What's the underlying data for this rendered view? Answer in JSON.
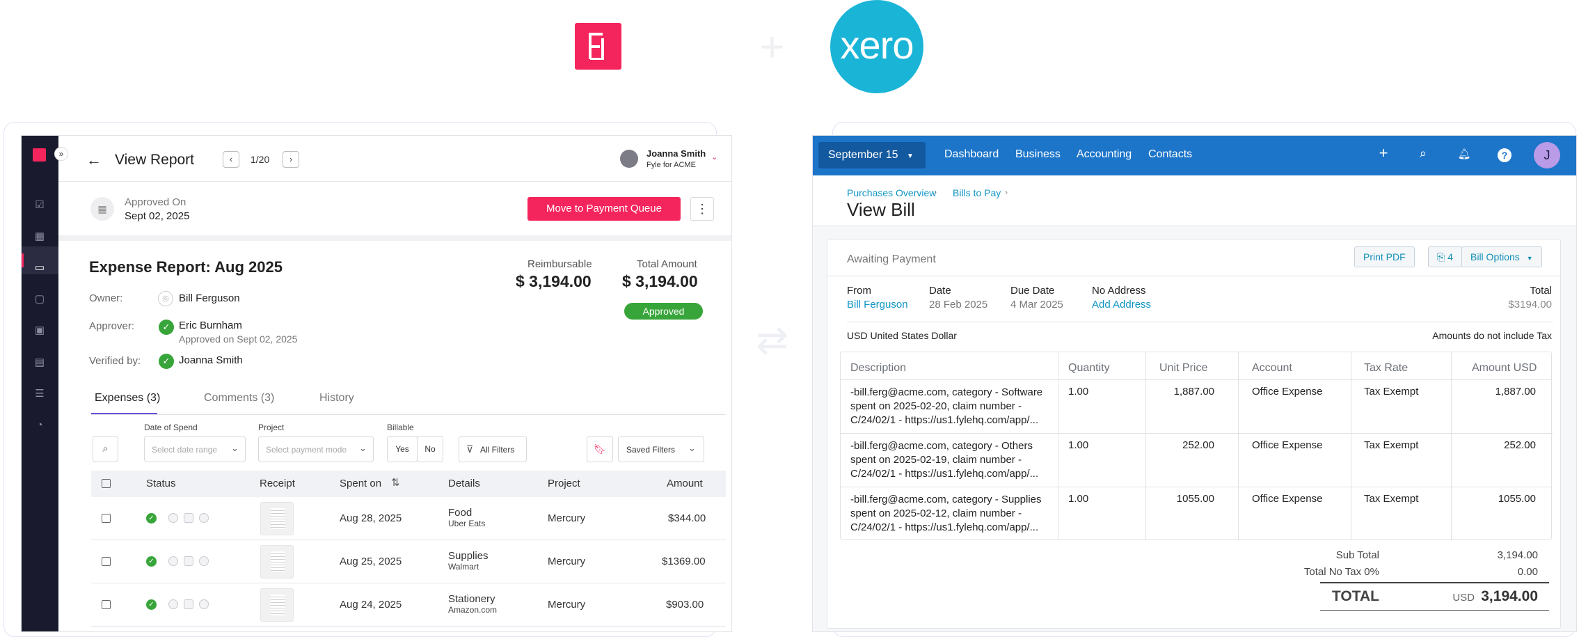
{
  "fyle": {
    "header": {
      "title": "View Report",
      "pager": "1/20",
      "user_name": "Joanna Smith",
      "user_org": "Fyle for ACME"
    },
    "approval": {
      "label": "Approved On",
      "date": "Sept 02, 2025",
      "action_button": "Move to Payment Queue"
    },
    "report": {
      "title": "Expense Report: Aug 2025",
      "reimbursable_label": "Reimbursable",
      "reimbursable_value": "$ 3,194.00",
      "total_label": "Total Amount",
      "total_value": "$ 3,194.00",
      "status": "Approved",
      "owner_label": "Owner:",
      "owner_name": "Bill Ferguson",
      "approver_label": "Approver:",
      "approver_name": "Eric Burnham",
      "approver_note": "Approved on Sept 02, 2025",
      "verified_label": "Verified by:",
      "verified_name": "Joanna Smith"
    },
    "tabs": [
      "Expenses (3)",
      "Comments (3)",
      "History"
    ],
    "filters": {
      "date_label": "Date of Spend",
      "date_placeholder": "Select date range",
      "project_label": "Project",
      "project_placeholder": "Select payment mode",
      "billable_label": "Billable",
      "billable_yes": "Yes",
      "billable_no": "No",
      "all_filters": "All Filters",
      "saved_filters": "Saved Filters"
    },
    "table": {
      "columns": [
        "Status",
        "Receipt",
        "Spent on",
        "Details",
        "Project",
        "Amount"
      ],
      "rows": [
        {
          "date": "Aug 28, 2025",
          "category": "Food",
          "merchant": "Uber Eats",
          "project": "Mercury",
          "amount": "$344.00"
        },
        {
          "date": "Aug 25, 2025",
          "category": "Supplies",
          "merchant": "Walmart",
          "project": "Mercury",
          "amount": "$1369.00"
        },
        {
          "date": "Aug 24, 2025",
          "category": "Stationery",
          "merchant": "Amazon.com",
          "project": "Mercury",
          "amount": "$903.00"
        }
      ]
    }
  },
  "xero": {
    "logo_text": "xero",
    "nav": {
      "org": "September 15",
      "links": [
        "Dashboard",
        "Business",
        "Accounting",
        "Contacts"
      ],
      "avatar": "J"
    },
    "breadcrumb": [
      "Purchases Overview",
      "Bills to Pay"
    ],
    "title": "View Bill",
    "status": "Awaiting Payment",
    "buttons": {
      "print": "Print PDF",
      "attachments": "4",
      "options": "Bill Options"
    },
    "summary": {
      "from_label": "From",
      "from_value": "Bill Ferguson",
      "date_label": "Date",
      "date_value": "28 Feb 2025",
      "due_label": "Due Date",
      "due_value": "4 Mar 2025",
      "address_label": "No Address",
      "address_link": "Add Address",
      "total_label": "Total",
      "total_value": "$3194.00"
    },
    "currency": "USD United States Dollar",
    "tax_note": "Amounts do not include Tax",
    "table": {
      "columns": [
        "Description",
        "Quantity",
        "Unit Price",
        "Account",
        "Tax Rate",
        "Amount USD"
      ],
      "rows": [
        {
          "desc1": "-bill.ferg@acme.com, category - Software",
          "desc2": "spent on 2025-02-20, claim number -",
          "desc3": "C/24/02/1 - https://us1.fylehq.com/app/...",
          "qty": "1.00",
          "price": "1,887.00",
          "account": "Office Expense",
          "tax": "Tax Exempt",
          "amount": "1,887.00"
        },
        {
          "desc1": "-bill.ferg@acme.com, category - Others",
          "desc2": "spent on 2025-02-19, claim number -",
          "desc3": "C/24/02/1 - https://us1.fylehq.com/app/...",
          "qty": "1.00",
          "price": "252.00",
          "account": "Office Expense",
          "tax": "Tax Exempt",
          "amount": "252.00"
        },
        {
          "desc1": "-bill.ferg@acme.com, category - Supplies",
          "desc2": "spent on 2025-02-12, claim number -",
          "desc3": "C/24/02/1 - https://us1.fylehq.com/app/...",
          "qty": "1.00",
          "price": "1055.00",
          "account": "Office Expense",
          "tax": "Tax Exempt",
          "amount": "1055.00"
        }
      ]
    },
    "totals": {
      "subtotal_label": "Sub Total",
      "subtotal_value": "3,194.00",
      "notax_label": "Total No Tax 0%",
      "notax_value": "0.00",
      "total_label": "TOTAL",
      "total_currency": "USD",
      "total_value": "3,194.00"
    }
  },
  "colors": {
    "fyle_pink": "#f4255d",
    "xero_blue": "#1ab4d7",
    "xero_nav": "#1c75c9",
    "approved_green": "#38a53a"
  }
}
